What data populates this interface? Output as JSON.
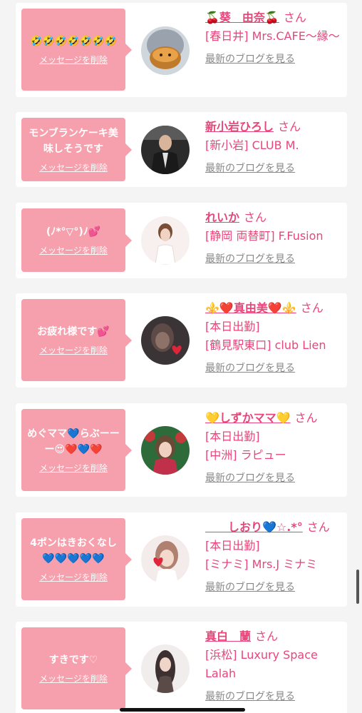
{
  "colors": {
    "bubble": "#f7a0ad",
    "accent": "#e8457a",
    "muted": "#888888",
    "background": "#f4f4f4",
    "card": "#ffffff"
  },
  "delete_label": "メッセージを削除",
  "blog_label": "最新のブログを見る",
  "san_label": "さん",
  "items": [
    {
      "message": "🤣🤣🤣🤣🤣🤣🤣",
      "name": "🍒葵　由奈🍒",
      "shop": "[春日井] Mrs.CAFE～縁～",
      "avatar": "cake-avatar"
    },
    {
      "message": "モンブランケーキ美味しそうです",
      "name": "新小岩ひろし",
      "shop": "[新小岩] CLUB M.",
      "avatar": "man-avatar"
    },
    {
      "message": "(ﾉ*°▽°)ﾉ💕",
      "name": "れいか",
      "shop": "[静岡 両替町] F.Fusion",
      "avatar": "woman-avatar"
    },
    {
      "message": "お疲れ様です💕",
      "name": "⚜️❤️真由美❤️⚜️",
      "shop": "[本日出勤]\n[鶴見駅東口] club Lien",
      "avatar": "woman-avatar"
    },
    {
      "message": "めぐママ💙らぶーーー😍❤️💙❤️",
      "name": "💛しずかママ💛",
      "shop": "[本日出勤]\n[中洲] ラピュー",
      "avatar": "woman-avatar"
    },
    {
      "message": "4ポンはきおくなし💙💙💙💙💙",
      "name": "　　しおり💙☆.*°",
      "shop": "[本日出勤]\n[ミナミ] Mrs.J ミナミ",
      "avatar": "woman-avatar"
    },
    {
      "message": "すきです♡",
      "name": "真白　蘭",
      "shop": "[浜松] Luxury Space Lalah",
      "avatar": "woman-avatar"
    }
  ]
}
